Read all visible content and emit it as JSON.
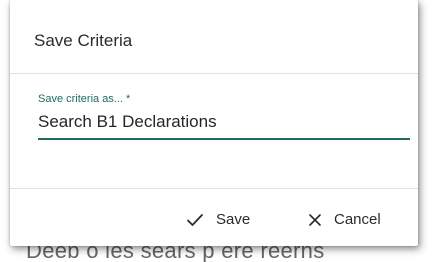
{
  "dialog": {
    "title": "Save Criteria",
    "field": {
      "label": "Save criteria as...",
      "required_marker": "*",
      "value": "Search B1 Declarations"
    },
    "footer": {
      "save_icon": "check-icon",
      "save_label": "Save",
      "cancel_icon": "close-icon",
      "cancel_label": "Cancel"
    }
  },
  "background": {
    "partial_text": "Deeb o ies sears p ere reerns"
  },
  "colors": {
    "accent": "#1f6b64",
    "text": "#2b2b2b",
    "divider": "#e2e2e2"
  }
}
